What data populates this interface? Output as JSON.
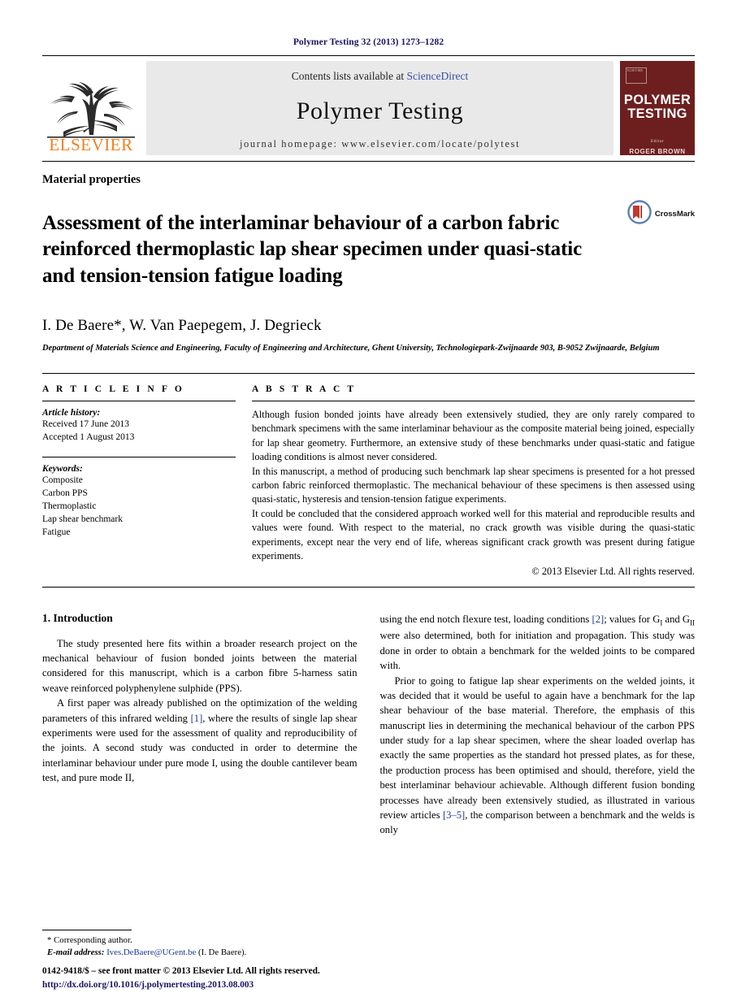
{
  "running_head": "Polymer Testing 32 (2013) 1273–1282",
  "banner": {
    "contents_prefix": "Contents lists available at ",
    "sciencedirect": "ScienceDirect",
    "journal_title": "Polymer Testing",
    "homepage": "journal homepage: www.elsevier.com/locate/polytest",
    "publisher_logo_word": "ELSEVIER",
    "cover": {
      "badge": "ELSEVIER",
      "title_line1": "POLYMER",
      "title_line2": "TESTING",
      "editor_label": "Editor",
      "editor_name": "ROGER BROWN"
    },
    "link_color": "#3a4fa0",
    "cover_color": "#6d1f1f",
    "elsevier_orange": "#f07f1a"
  },
  "section_kind": "Material properties",
  "article": {
    "title": "Assessment of the interlaminar behaviour of a carbon fabric reinforced thermoplastic lap shear specimen under quasi-static and tension-tension fatigue loading",
    "crossmark_label": "CrossMark",
    "authors": "I. De Baere*, W. Van Paepegem, J. Degrieck",
    "affiliation": "Department of Materials Science and Engineering, Faculty of Engineering and Architecture, Ghent University, Technologiepark-Zwijnaarde 903, B-9052 Zwijnaarde, Belgium"
  },
  "article_info": {
    "heading": "A R T I C L E   I N F O",
    "history_label": "Article history:",
    "history": [
      "Received 17 June 2013",
      "Accepted 1 August 2013"
    ],
    "keywords_label": "Keywords:",
    "keywords": [
      "Composite",
      "Carbon PPS",
      "Thermoplastic",
      "Lap shear benchmark",
      "Fatigue"
    ]
  },
  "abstract": {
    "heading": "A B S T R A C T",
    "paragraphs": [
      "Although fusion bonded joints have already been extensively studied, they are only rarely compared to benchmark specimens with the same interlaminar behaviour as the composite material being joined, especially for lap shear geometry. Furthermore, an extensive study of these benchmarks under quasi-static and fatigue loading conditions is almost never considered.",
      "In this manuscript, a method of producing such benchmark lap shear specimens is presented for a hot pressed carbon fabric reinforced thermoplastic. The mechanical behaviour of these specimens is then assessed using quasi-static, hysteresis and tension-tension fatigue experiments.",
      "It could be concluded that the considered approach worked well for this material and reproducible results and values were found. With respect to the material, no crack growth was visible during the quasi-static experiments, except near the very end of life, whereas significant crack growth was present during fatigue experiments."
    ],
    "copyright": "© 2013 Elsevier Ltd. All rights reserved."
  },
  "introduction": {
    "heading": "1. Introduction",
    "left_paragraphs": [
      "The study presented here fits within a broader research project on the mechanical behaviour of fusion bonded joints between the material considered for this manuscript, which is a carbon fibre 5-harness satin weave reinforced polyphenylene sulphide (PPS).",
      "A first paper was already published on the optimization of the welding parameters of this infrared welding [1], where the results of single lap shear experiments were used for the assessment of quality and reproducibility of the joints. A second study was conducted in order to determine the interlaminar behaviour under pure mode I, using the double cantilever beam test, and pure mode II,"
    ],
    "right_paragraphs": [
      "using the end notch flexure test, loading conditions [2]; values for GI and GII were also determined, both for initiation and propagation. This study was done in order to obtain a benchmark for the welded joints to be compared with.",
      "Prior to going to fatigue lap shear experiments on the welded joints, it was decided that it would be useful to again have a benchmark for the lap shear behaviour of the base material. Therefore, the emphasis of this manuscript lies in determining the mechanical behaviour of the carbon PPS under study for a lap shear specimen, where the shear loaded overlap has exactly the same properties as the standard hot pressed plates, as for these, the production process has been optimised and should, therefore, yield the best interlaminar behaviour achievable. Although different fusion bonding processes have already been extensively studied, as illustrated in various review articles [3–5], the comparison between a benchmark and the welds is only"
    ],
    "citations": [
      "1",
      "2",
      "3–5"
    ]
  },
  "footnote": {
    "corresponding": "* Corresponding author.",
    "email_label": "E-mail address:",
    "email": "Ives.DeBaere@UGent.be",
    "email_suffix": "(I. De Baere)."
  },
  "footer": {
    "issn": "0142-9418/$ – see front matter © 2013 Elsevier Ltd. All rights reserved.",
    "doi": "http://dx.doi.org/10.1016/j.polymertesting.2013.08.003"
  }
}
